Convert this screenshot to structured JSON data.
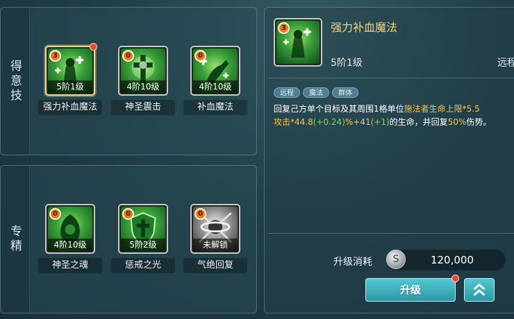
{
  "specialty_panel": {
    "title": "得意技",
    "skills": [
      {
        "name": "强力补血魔法",
        "level": "5阶1级",
        "badge": "3",
        "selected": true,
        "red_dot": true,
        "icon": "healer-cross-icon"
      },
      {
        "name": "神圣震击",
        "level": "4阶10级",
        "badge": "0",
        "selected": false,
        "red_dot": false,
        "icon": "holy-cross-burst-icon"
      },
      {
        "name": "补血魔法",
        "level": "4阶10级",
        "badge": "0",
        "selected": false,
        "red_dot": false,
        "icon": "heal-hand-icon"
      }
    ]
  },
  "mastery_panel": {
    "title": "专精",
    "skills": [
      {
        "name": "神圣之魂",
        "level": "4阶10级",
        "badge": "0",
        "icon": "holy-soul-icon"
      },
      {
        "name": "惩戒之光",
        "level": "5阶2级",
        "badge": "0",
        "icon": "shield-cross-icon"
      },
      {
        "name": "气绝回复",
        "level": "未解锁",
        "badge": "0",
        "icon": "ringed-orb-icon",
        "locked": true
      }
    ]
  },
  "detail": {
    "title": "强力补血魔法",
    "badge": "3",
    "level": "5阶1级",
    "range": "远程",
    "tags": [
      "远程",
      "魔法",
      "群体"
    ],
    "desc_line1_a": "回复己方单个目标及其周围1格单位",
    "desc_line1_b": "施法者生命上限*5.5",
    "desc_line2_a": "攻击*44.8",
    "desc_line2_b": "(+0.24)",
    "desc_line2_c": "%+41",
    "desc_line2_d": "(+1)",
    "desc_line2_e": "的生命，并回复",
    "desc_line2_f": "50%",
    "desc_line2_g": "伤势。"
  },
  "upgrade": {
    "cost_label": "升级消耗",
    "cost_value": "120,000",
    "button_label": "升级"
  },
  "colors": {
    "accent": "#3fb0bd",
    "highlight": "#f4c64a",
    "bonus": "#7ed957",
    "badge": "#ea7a1d",
    "notice": "#f4462b"
  }
}
